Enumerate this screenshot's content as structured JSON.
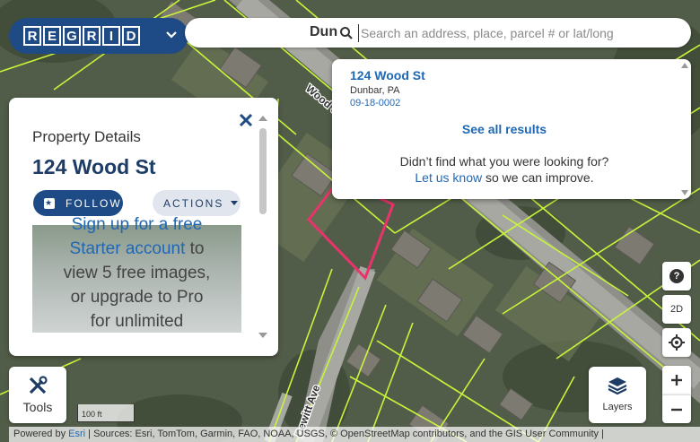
{
  "app": {
    "logo_letters": [
      "R",
      "E",
      "G",
      "R",
      "I",
      "D"
    ],
    "brand_color": "#1e4a85"
  },
  "search": {
    "behind_text": "Dun",
    "placeholder": "Search an address, place, parcel # or lat/long",
    "value": ""
  },
  "results": {
    "items": [
      {
        "title": "124 Wood St",
        "city": "Dunbar, PA",
        "parcel": "09-18-0002"
      }
    ],
    "see_all": "See all results",
    "not_found": "Didn’t find what you were looking for?",
    "let_us_know": "Let us know",
    "improve": "so we can improve."
  },
  "panel": {
    "subtitle": "Property Details",
    "title": "124 Wood St",
    "follow_label": "FOLLOW",
    "actions_label": "ACTIONS",
    "promo": {
      "line1a": "Sign up for a free",
      "line2_link": "Starter account",
      "line2_rest": " to",
      "line3": "view 5 free images,",
      "line4": "or upgrade to Pro",
      "line5": "for unlimited"
    }
  },
  "map": {
    "street_labels": [
      "Wood St",
      "Dewitt Ave"
    ],
    "parcel_line_color": "#c8f53a",
    "highlight_color": "#e8336b",
    "scale_label": "100 ft"
  },
  "tools": {
    "label": "Tools"
  },
  "layers": {
    "label": "Layers"
  },
  "controls": {
    "help": "?",
    "mode": "2D"
  },
  "attribution": {
    "powered_prefix": "Powered by ",
    "powered_link": "Esri",
    "sources": " | Sources: Esri, TomTom, Garmin, FAO, NOAA, USGS, © OpenStreetMap contributors, and the GIS User Community |"
  }
}
